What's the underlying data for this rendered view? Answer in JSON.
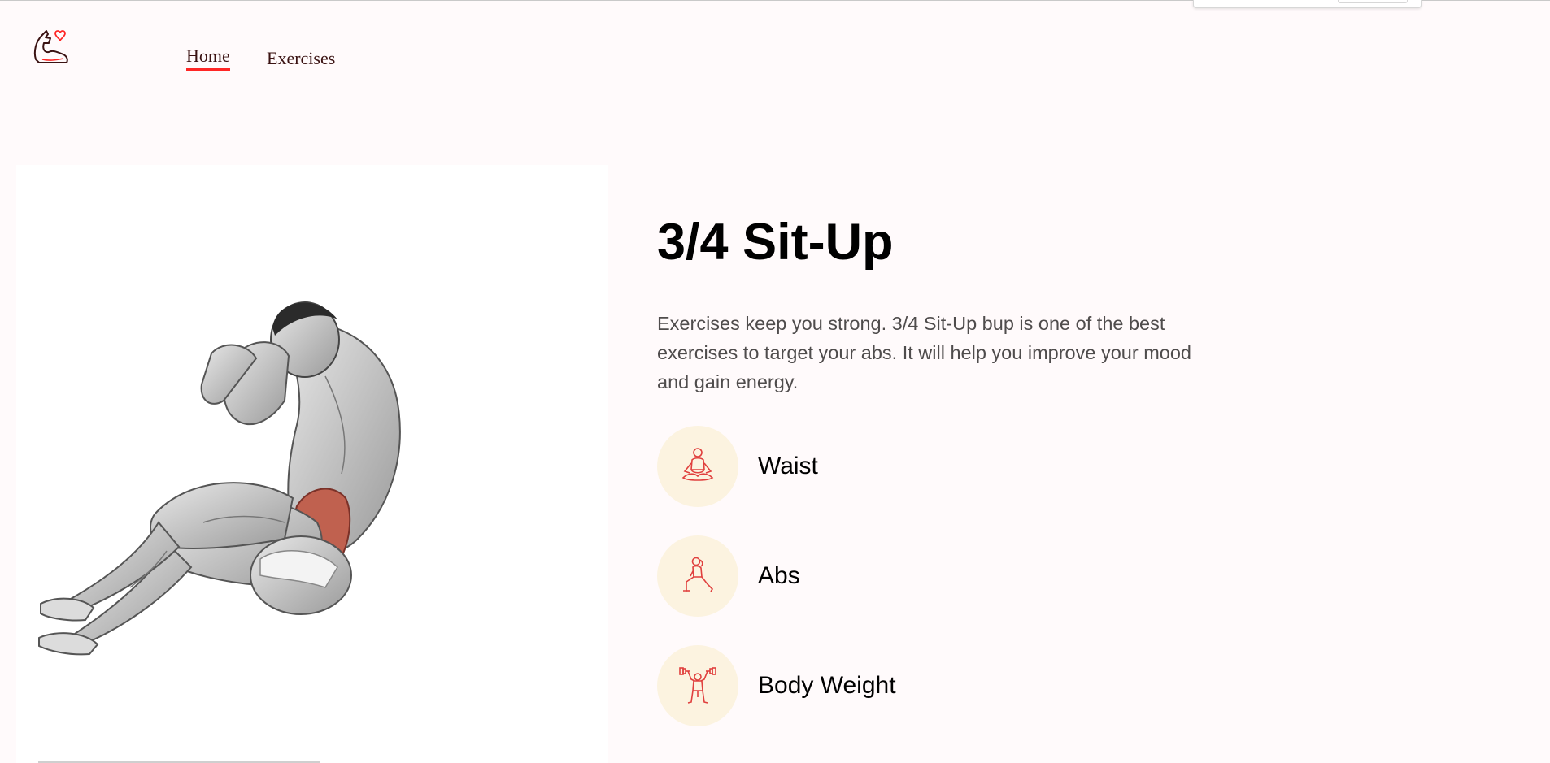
{
  "navbar": {
    "logo_icon": "flexed-bicep-heart-icon",
    "links": [
      {
        "label": "Home",
        "active": true
      },
      {
        "label": "Exercises",
        "active": false
      }
    ]
  },
  "exercise": {
    "image_alt": "muscle-figure-sit-up-icon",
    "name": "3/4 Sit-Up",
    "description": "Exercises keep you strong. 3/4 Sit-Up bup is one of the best exercises to target your abs. It will help you improve your mood and gain energy.",
    "details": [
      {
        "icon": "meditation-pose-icon",
        "label": "Waist"
      },
      {
        "icon": "lunge-woman-icon",
        "label": "Abs"
      },
      {
        "icon": "dumbbell-lift-icon",
        "label": "Body Weight"
      }
    ]
  },
  "colors": {
    "accent": "#ff2625",
    "background": "#fffafb",
    "icon_circle": "#fcf3e0"
  }
}
